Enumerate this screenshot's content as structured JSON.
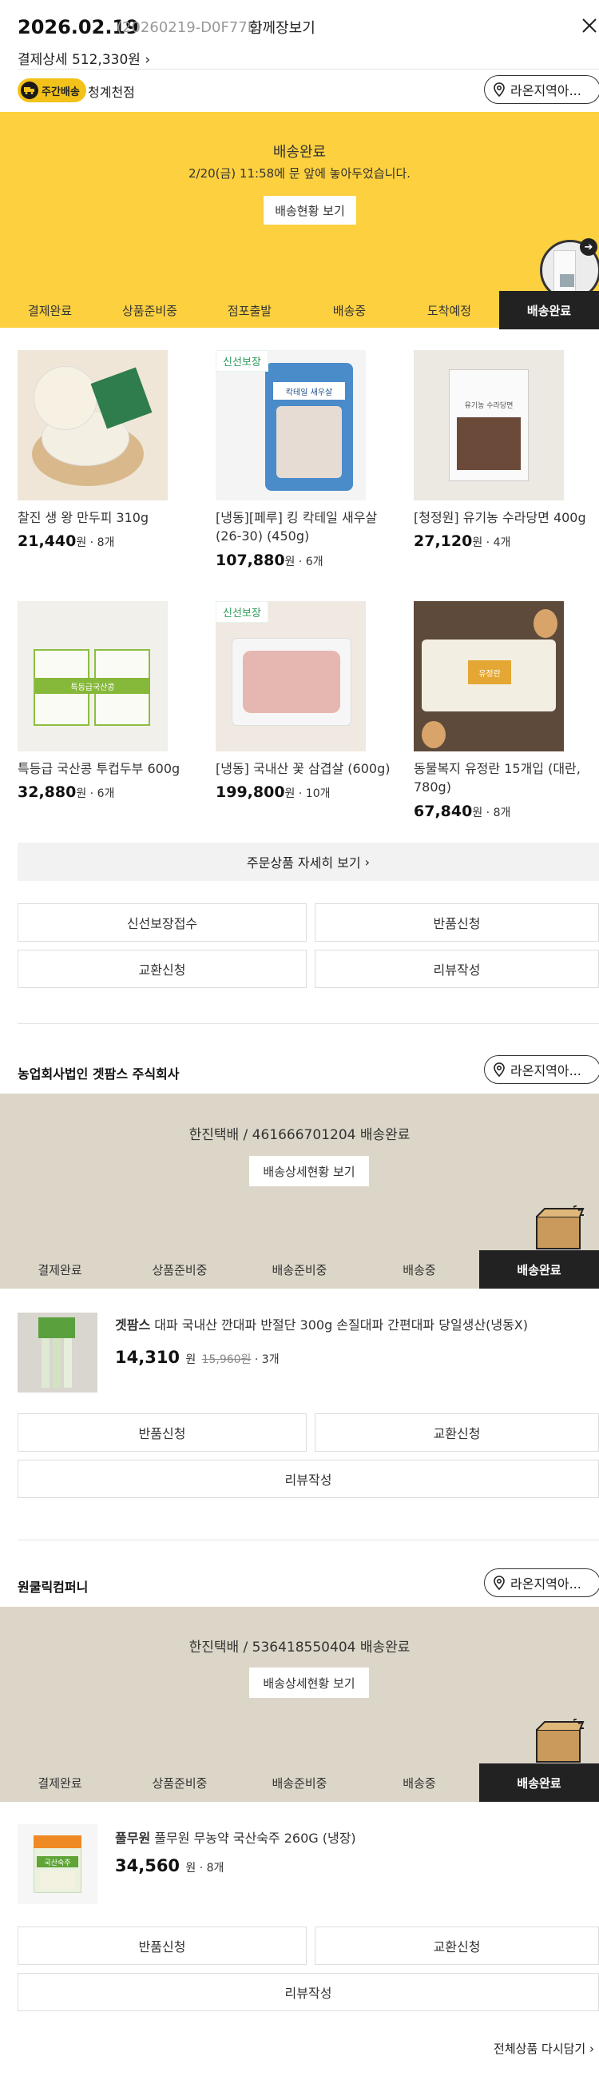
{
  "header": {
    "date": "2026.02.19",
    "order_id": "(20260219-D0F77E)",
    "together": "함께장보기",
    "payment": "결제상세 512,330원"
  },
  "delivery_badge": "주간배송",
  "branch": "청계천점",
  "location": "라온지역아...",
  "banner": {
    "title": "배송완료",
    "message": "2/20(금) 11:58에 문 앞에 놓아두었습니다.",
    "button": "배송현황 보기"
  },
  "steps1": [
    "결제완료",
    "상품준비중",
    "점포출발",
    "배송중",
    "도착예정",
    "배송완료"
  ],
  "fresh_label": "신선보장",
  "products": [
    {
      "name": "찰진 생 왕 만두피 310g",
      "price": "21,440",
      "unit": "원",
      "qty": "8개"
    },
    {
      "name": "[냉동][페루] 킹 칵테일 새우살 (26-30) (450g)",
      "price": "107,880",
      "unit": "원",
      "qty": "6개"
    },
    {
      "name": "[청정원] 유기농 수라당면 400g",
      "price": "27,120",
      "unit": "원",
      "qty": "4개"
    },
    {
      "name": "특등급 국산콩 투컵두부 600g",
      "price": "32,880",
      "unit": "원",
      "qty": "6개"
    },
    {
      "name": "[냉동] 국내산 꽃 삼겹살 (600g)",
      "price": "199,800",
      "unit": "원",
      "qty": "10개"
    },
    {
      "name": "동물복지 유정란 15개입 (대란, 780g)",
      "price": "67,840",
      "unit": "원",
      "qty": "8개"
    }
  ],
  "product_img_text": {
    "shrimp": "칵테일 새우살",
    "noodle": "유기농 수라당면",
    "tofu": "특등급국산콩",
    "egg": "유정란"
  },
  "order_detail": "주문상품 자세히 보기",
  "actions1": [
    "신선보장접수",
    "반품신청",
    "교환신청",
    "리뷰작성"
  ],
  "seller1": {
    "name": "농업회사법인 겟팜스 주식회사",
    "tracking": "한진택배 / 461666701204 배송완료",
    "track_btn": "배송상세현황 보기",
    "steps": [
      "결제완료",
      "상품준비중",
      "배송준비중",
      "배송중",
      "배송완료"
    ],
    "item": {
      "brand": "겟팜스",
      "name": "대파 국내산 깐대파 반절단 300g 손질대파 간편대파 당일생산(냉동X)",
      "price": "14,310",
      "unit": "원",
      "orig": "15,960원",
      "qty": "3개"
    },
    "actions": [
      "반품신청",
      "교환신청",
      "리뷰작성"
    ]
  },
  "seller2": {
    "name": "원쿨릭컴퍼니",
    "tracking": "한진택배 / 536418550404 배송완료",
    "track_btn": "배송상세현황 보기",
    "steps": [
      "결제완료",
      "상품준비중",
      "배송준비중",
      "배송중",
      "배송완료"
    ],
    "item": {
      "brand": "풀무원",
      "name": "풀무원 무농약 국산숙주 260G (냉장)",
      "price": "34,560",
      "unit": "원",
      "qty": "8개",
      "img_text": "국산숙주"
    },
    "actions": [
      "반품신청",
      "교환신청",
      "리뷰작성"
    ]
  },
  "reorder": "전체상품 다시담기"
}
